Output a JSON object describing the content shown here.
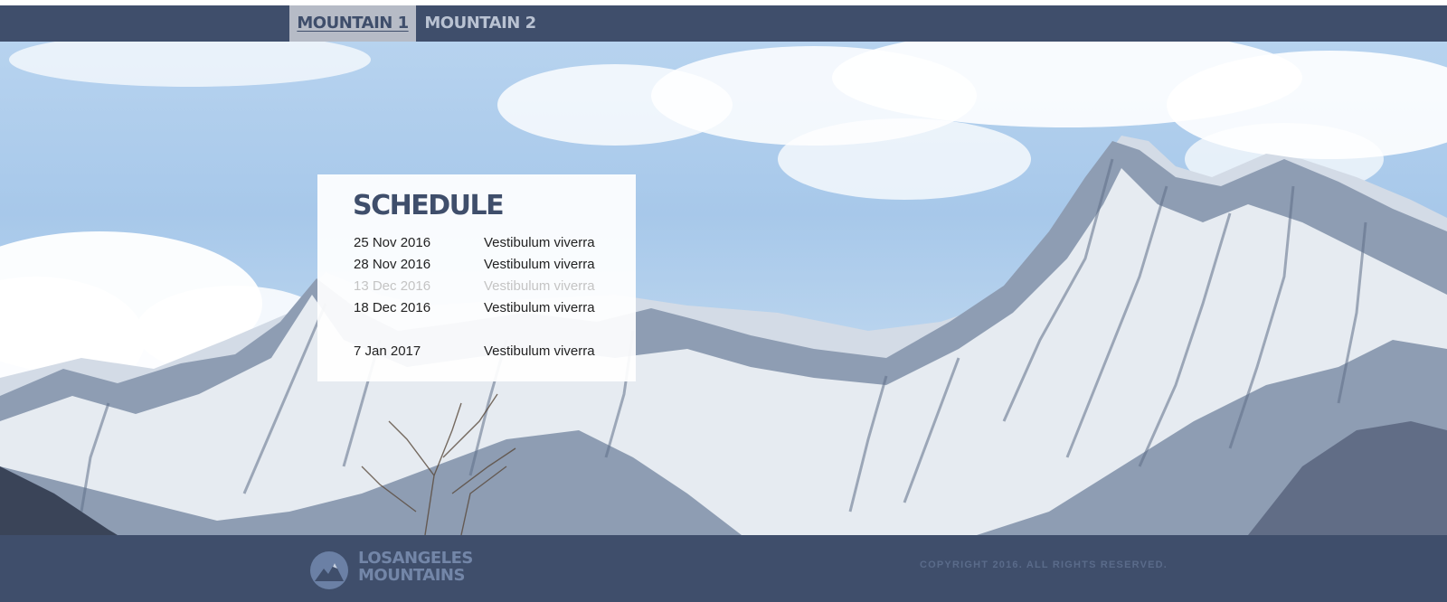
{
  "nav": {
    "tabs": [
      {
        "label": "MOUNTAIN 1",
        "active": true
      },
      {
        "label": "MOUNTAIN 2",
        "active": false
      }
    ]
  },
  "hero": {
    "image": "snowy-mountain-photo"
  },
  "schedule": {
    "title": "SCHEDULE",
    "rows": [
      {
        "date": "25 Nov 2016",
        "event": "Vestibulum viverra",
        "state": "normal"
      },
      {
        "date": "28 Nov 2016",
        "event": "Vestibulum viverra",
        "state": "normal"
      },
      {
        "date": "13 Dec 2016",
        "event": "Vestibulum viverra",
        "state": "faded"
      },
      {
        "date": "18 Dec 2016",
        "event": "Vestibulum viverra",
        "state": "normal"
      },
      {
        "date": "7 Jan 2017",
        "event": "Vestibulum viverra",
        "state": "normal"
      }
    ]
  },
  "footer": {
    "logo": {
      "line1": "LOSANGELES",
      "line2": "MOUNTAINS",
      "icon": "mountain-logo-icon"
    },
    "copyright": "COPYRIGHT 2016. ALL RIGHTS RESERVED."
  },
  "colors": {
    "brand": "#3f4e6b",
    "active_tab": "#b6bbc6",
    "inactive_tab_text": "#b9c2d2",
    "logo_text": "#7386a8"
  }
}
